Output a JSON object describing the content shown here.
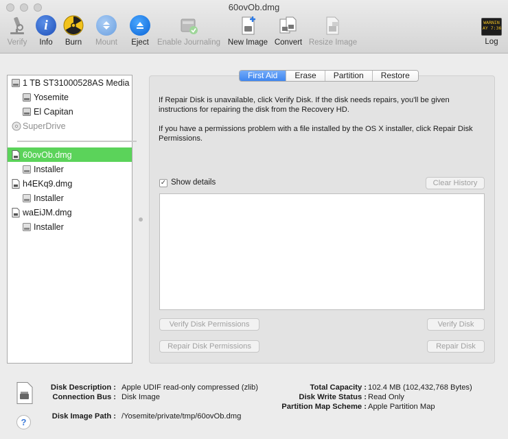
{
  "window": {
    "title": "60ovOb.dmg"
  },
  "toolbar": {
    "verify": "Verify",
    "info": "Info",
    "burn": "Burn",
    "mount": "Mount",
    "eject": "Eject",
    "enable_journaling": "Enable Journaling",
    "new_image": "New Image",
    "convert": "Convert",
    "resize_image": "Resize Image",
    "log": "Log",
    "log_icon_text1": "WARNIN",
    "log_icon_text2": "AY 7:36"
  },
  "sidebar": {
    "items": [
      {
        "label": "1 TB ST31000528AS Media",
        "icon": "hard-drive-icon"
      },
      {
        "label": "Yosemite",
        "icon": "volume-icon"
      },
      {
        "label": "El Capitan",
        "icon": "volume-icon"
      },
      {
        "label": "SuperDrive",
        "icon": "optical-drive-icon"
      },
      {
        "label": "60ovOb.dmg",
        "icon": "disk-image-icon",
        "selected": true
      },
      {
        "label": "Installer",
        "icon": "volume-icon"
      },
      {
        "label": "h4EKq9.dmg",
        "icon": "disk-image-icon"
      },
      {
        "label": "Installer",
        "icon": "volume-icon"
      },
      {
        "label": "waEiJM.dmg",
        "icon": "disk-image-icon"
      },
      {
        "label": "Installer",
        "icon": "volume-icon"
      }
    ]
  },
  "tabs": [
    "First Aid",
    "Erase",
    "Partition",
    "Restore"
  ],
  "first_aid": {
    "paragraph1": "If Repair Disk is unavailable, click Verify Disk. If the disk needs repairs, you'll be given instructions for repairing the disk from the Recovery HD.",
    "paragraph2": "If you have a permissions problem with a file installed by the OS X installer, click Repair Disk Permissions.",
    "show_details": "Show details",
    "clear_history": "Clear History",
    "verify_permissions": "Verify Disk Permissions",
    "verify_disk": "Verify Disk",
    "repair_permissions": "Repair Disk Permissions",
    "repair_disk": "Repair Disk"
  },
  "info": {
    "disk_description_label": "Disk Description :",
    "disk_description": "Apple UDIF read-only compressed (zlib)",
    "connection_bus_label": "Connection Bus :",
    "connection_bus": "Disk Image",
    "disk_image_path_label": "Disk Image Path :",
    "disk_image_path": "/Yosemite/private/tmp/60ovOb.dmg",
    "total_capacity_label": "Total Capacity :",
    "total_capacity": "102.4 MB (102,432,768 Bytes)",
    "write_status_label": "Disk Write Status :",
    "write_status": "Read Only",
    "partition_scheme_label": "Partition Map Scheme :",
    "partition_scheme": "Apple Partition Map"
  },
  "help_label": "?",
  "colors": {
    "selection": "#5bd35a",
    "tab_active": "#3f86f0",
    "accent_blue": "#2e7be6"
  }
}
